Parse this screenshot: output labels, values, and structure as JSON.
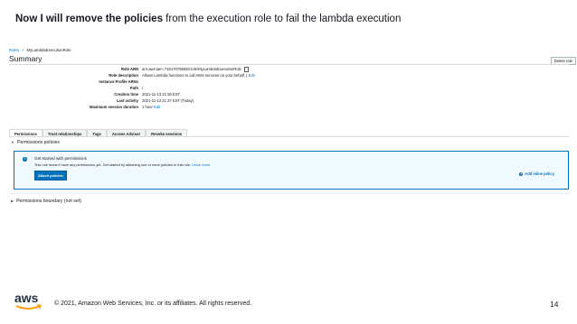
{
  "slide": {
    "title_bold": "Now I will remove the policies",
    "title_rest": " from the execution role to fail the lambda execution"
  },
  "breadcrumb": {
    "root": "Roles",
    "separator": ">",
    "current": "MyLambdaExecutionRole"
  },
  "page": {
    "heading": "Summary",
    "delete_label": "Delete role"
  },
  "summary": [
    {
      "label": "Role ARN",
      "value": "arn:aws:iam::716170765583:role/MyLambdaExecutionRole",
      "link": ""
    },
    {
      "label": "Role description",
      "value": "Allows Lambda functions to call AWS services on your behalf.",
      "link": "Edit"
    },
    {
      "label": "Instance Profile ARNs",
      "value": "",
      "link": ""
    },
    {
      "label": "Path",
      "value": "/",
      "link": ""
    },
    {
      "label": "Creation time",
      "value": "2021-11-13 21:36 EST",
      "link": ""
    },
    {
      "label": "Last activity",
      "value": "2021-11-13 21:37 EST (Today)",
      "link": ""
    },
    {
      "label": "Maximum session duration",
      "value": "1 hour",
      "link": "Edit"
    }
  ],
  "tabs": [
    {
      "label": "Permissions",
      "active": true
    },
    {
      "label": "Trust relationships",
      "active": false
    },
    {
      "label": "Tags",
      "active": false
    },
    {
      "label": "Access Advisor",
      "active": false
    },
    {
      "label": "Revoke sessions",
      "active": false
    }
  ],
  "permissions": {
    "section_title": "Permissions policies",
    "info_title": "Get started with permissions",
    "info_text": "This role doesn't have any permissions yet. Get started by attaching one or more policies to this role.",
    "learn_more": "Learn more",
    "attach_label": "Attach policies",
    "inline_label": "Add inline policy",
    "boundary_title": "Permissions boundary (not set)"
  },
  "footer": {
    "logo_text": "aws",
    "copyright": "© 2021, Amazon Web Services, Inc. or its affiliates. All rights reserved.",
    "page_number": "14"
  },
  "colors": {
    "link": "#0073bb",
    "info_bg": "#f1faff",
    "logo_orange": "#ff9900",
    "text": "#16191f"
  }
}
